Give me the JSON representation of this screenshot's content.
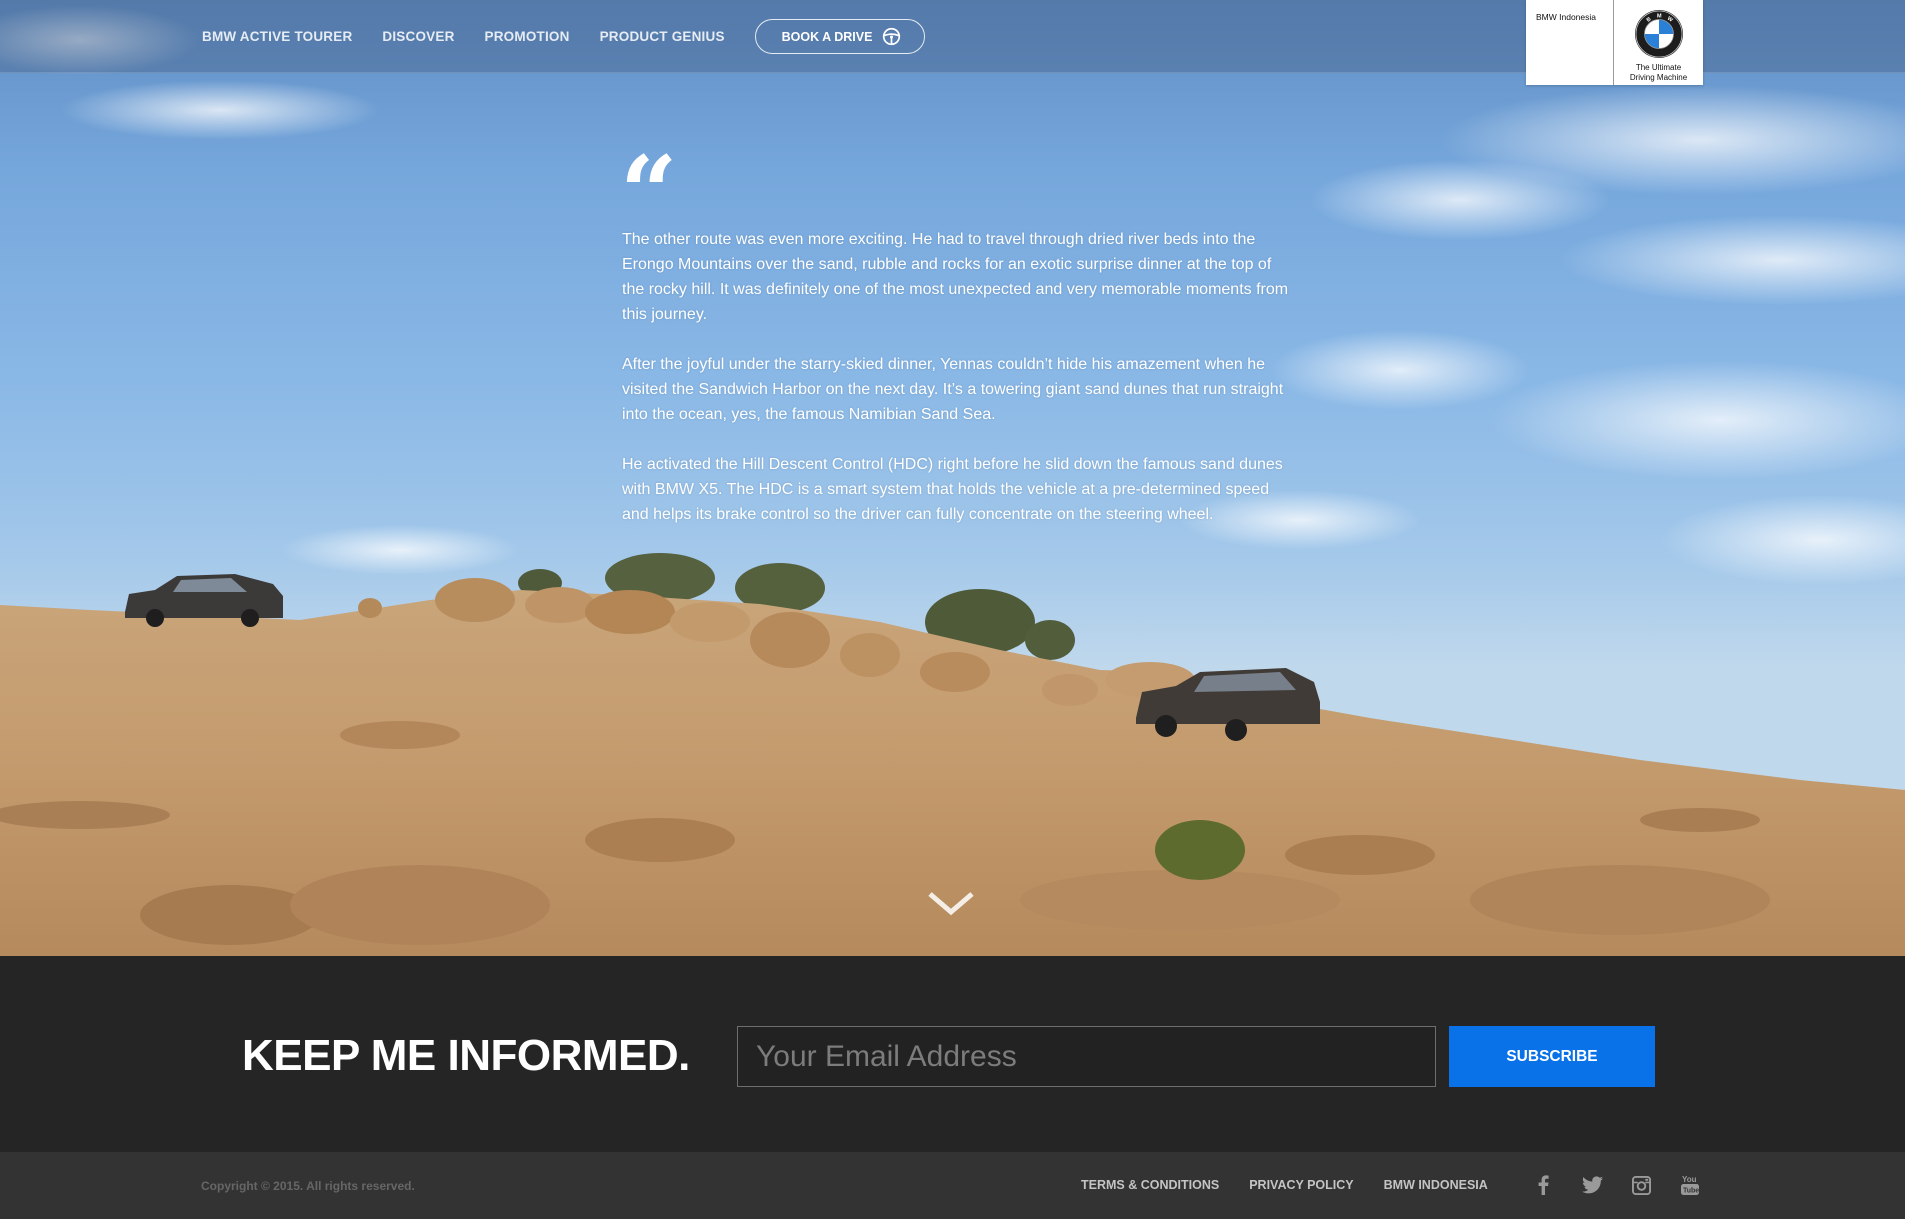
{
  "nav": {
    "links": [
      "BMW ACTIVE TOURER",
      "DISCOVER",
      "PROMOTION",
      "PRODUCT GENIUS"
    ],
    "book_label": "BOOK A DRIVE",
    "book_icon": "steering-wheel-icon"
  },
  "brand": {
    "site_name": "BMW Indonesia",
    "logo_letters": "BMW",
    "tagline_line1": "The Ultimate",
    "tagline_line2": "Driving Machine"
  },
  "quote": {
    "mark": "“",
    "paragraphs": [
      "The other route was even more exciting. He had to travel through dried river beds into the Erongo Mountains over the sand, rubble and rocks for an exotic surprise dinner at the top of the rocky hill. It was definitely one of the most unexpected and very memorable moments from this journey.",
      "After the joyful under the starry-skied dinner, Yennas couldn’t hide his amazement when he visited the Sandwich Harbor on the next day. It’s a towering giant sand dunes that run straight into the ocean, yes, the famous Namibian Sand Sea.",
      "He activated the Hill Descent Control (HDC) right before he slid down the famous sand dunes with BMW X5. The HDC is a smart system that holds the vehicle at a pre-determined speed and helps its brake control so the driver can fully concentrate on the steering wheel."
    ]
  },
  "newsletter": {
    "title": "KEEP ME INFORMED.",
    "email_placeholder": "Your Email Address",
    "email_value": "",
    "subscribe_label": "SUBSCRIBE"
  },
  "footer": {
    "copyright": "Copyright © 2015. All rights reserved.",
    "links": [
      "TERMS & CONDITIONS",
      "PRIVACY POLICY",
      "BMW INDONESIA"
    ],
    "social_icons": [
      "facebook-icon",
      "twitter-icon",
      "instagram-icon",
      "youtube-icon"
    ]
  },
  "colors": {
    "accent_blue": "#0a72e8",
    "newsletter_bg": "#252525",
    "footer_bg": "#333333"
  }
}
